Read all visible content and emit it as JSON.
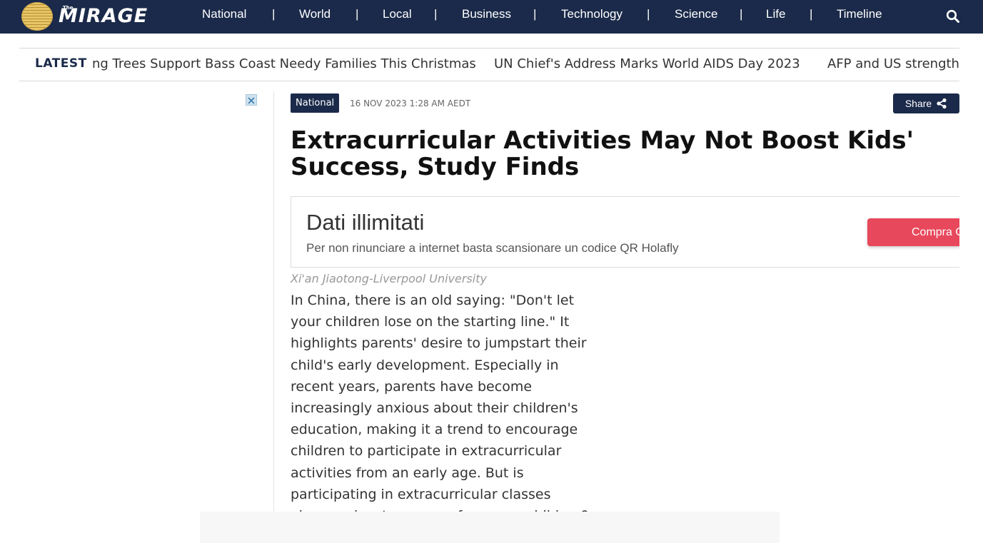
{
  "logo": {
    "small": "The",
    "word": "MIRAGE"
  },
  "nav": {
    "items": [
      "National",
      "World",
      "Local",
      "Business",
      "Technology",
      "Science",
      "Life",
      "Timeline"
    ],
    "separator": "|"
  },
  "ticker": {
    "label": "LATEST",
    "items": [
      "ng Trees Support Bass Coast Needy Families This Christmas",
      "UN Chief's Address Marks World AIDS Day 2023",
      "AFP and US strengthen"
    ]
  },
  "article": {
    "category": "National",
    "date": "16 NOV 2023 1:28 AM AEDT",
    "share_label": "Share",
    "headline": "Extracurricular Activities May Not Boost Kids' Success, Study Finds",
    "byline": "Xi'an Jiaotong-Liverpool University",
    "body": "In China, there is an old saying: \"Don't let your children lose on the starting line.\" It highlights parents' desire to jumpstart their child's early development. Especially in recent years, parents have become increasingly anxious about their children's education, making it a trend to encourage children to participate in extracurricular activities from an early age. But is participating in extracurricular classes always a key to success for young children?"
  },
  "ad": {
    "title": "Dati illimitati",
    "subtitle": "Per non rinunciare a internet basta scansionare un codice QR Holafly",
    "cta": "Compra Ora"
  },
  "colors": {
    "navy": "#1b2a4a",
    "ad_cta": "#e8485b",
    "byline": "#999999"
  }
}
